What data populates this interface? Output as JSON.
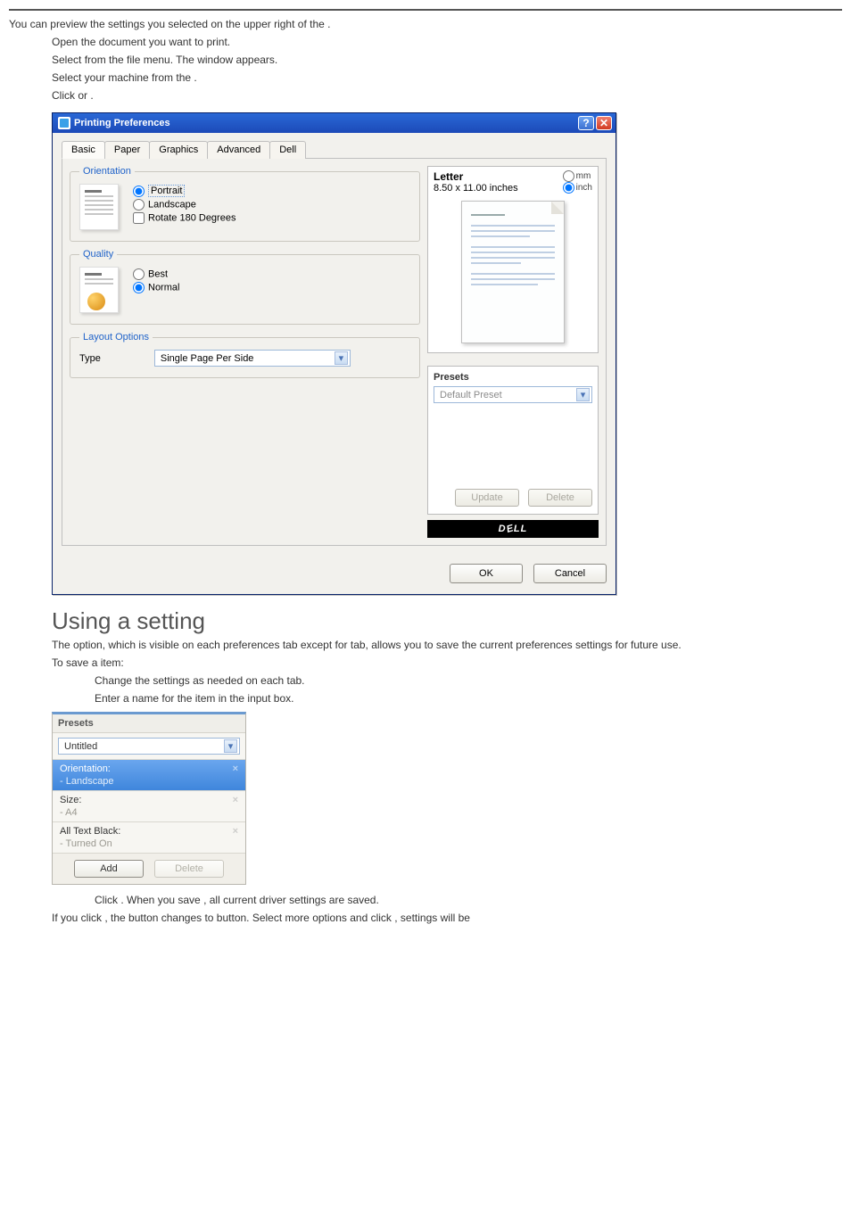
{
  "intro": {
    "line1": "You can preview the settings you selected on the upper right of the ",
    "line1_end": ".",
    "step1": "Open the document you want to print.",
    "step2_a": "Select ",
    "step2_b": " from the file menu. The ",
    "step2_c": " window appears.",
    "step3_a": "Select your machine from the ",
    "step3_b": ".",
    "step4_a": "Click ",
    "step4_b": " or ",
    "step4_c": "."
  },
  "dialog": {
    "title": "Printing Preferences",
    "tabs": [
      "Basic",
      "Paper",
      "Graphics",
      "Advanced",
      "Dell"
    ],
    "orientation": {
      "legend": "Orientation",
      "portrait": "Portrait",
      "landscape": "Landscape",
      "rotate": "Rotate 180 Degrees"
    },
    "quality": {
      "legend": "Quality",
      "best": "Best",
      "normal": "Normal"
    },
    "layout": {
      "legend": "Layout Options",
      "type": "Type",
      "selected": "Single Page Per Side"
    },
    "preview": {
      "size_name": "Letter",
      "size_value": "8.50 x 11.00 inches",
      "mm": "mm",
      "inch": "inch"
    },
    "presets": {
      "title": "Presets",
      "selected": "Default Preset",
      "update": "Update",
      "delete": "Delete"
    },
    "brand": "DELL",
    "ok": "OK",
    "cancel": "Cancel"
  },
  "presets_section": {
    "heading_a": "Using a ",
    "heading_b": " setting",
    "para_a": "The ",
    "para_b": " option, which is visible on each preferences tab except for ",
    "para_c": " tab, allows you to save the current preferences settings for future use.",
    "to_save_a": "To save a ",
    "to_save_b": " item:",
    "step1": "Change the settings as needed on each tab.",
    "step2_a": "Enter a name for the item in the ",
    "step2_b": " input box."
  },
  "presets_panel": {
    "header": "Presets",
    "name": "Untitled",
    "items": [
      {
        "label": "Orientation:",
        "value": "- Landscape"
      },
      {
        "label": "Size:",
        "value": "- A4"
      },
      {
        "label": "All Text Black:",
        "value": "- Turned On"
      }
    ],
    "add": "Add",
    "delete": "Delete"
  },
  "after_panel": {
    "step3_a": "Click ",
    "step3_b": ". When you save ",
    "step3_c": ", all current driver settings are saved.",
    "if_a": "If you click ",
    "if_b": ", the ",
    "if_c": " button changes to ",
    "if_d": " button. Select more options and click ",
    "if_e": ", settings will be"
  }
}
